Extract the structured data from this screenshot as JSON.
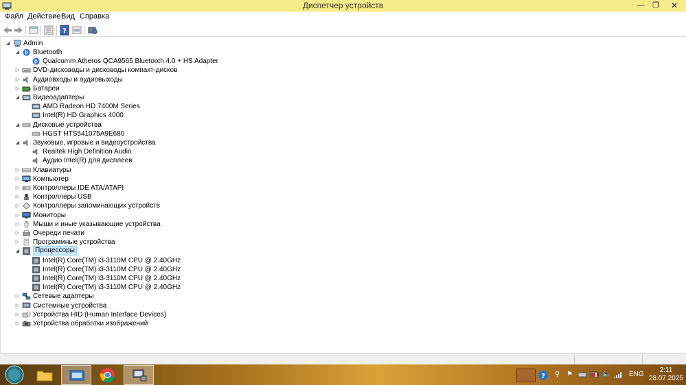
{
  "window": {
    "title": "Диспетчер устройств",
    "min_glyph": "—",
    "max_glyph": "❐",
    "close_glyph": "✕"
  },
  "menu": [
    {
      "label": "Файл"
    },
    {
      "label": "Действие"
    },
    {
      "label": "Вид"
    },
    {
      "label": "Справка"
    }
  ],
  "toolbar": {
    "icons": [
      "back-icon",
      "forward-icon",
      "properties-icon",
      "list-view-icon",
      "help-icon",
      "device-view-icon",
      "scan-hardware-icon"
    ]
  },
  "tree": {
    "root": "Admin",
    "nodes": [
      {
        "label": "Bluetooth",
        "level": 1,
        "expanded": true,
        "icon": "bluetooth-icon"
      },
      {
        "label": "Qualcomm Atheros QCA9565 Bluetooth 4.0 + HS Adapter",
        "level": 2,
        "icon": "bluetooth-icon"
      },
      {
        "label": "DVD-дисководы и дисководы компакт-дисков",
        "level": 1,
        "expanded": false,
        "icon": "dvd-drive-icon"
      },
      {
        "label": "Аудиовходы и аудиовыходы",
        "level": 1,
        "expanded": false,
        "icon": "speaker-icon"
      },
      {
        "label": "Батареи",
        "level": 1,
        "expanded": false,
        "icon": "battery-icon"
      },
      {
        "label": "Видеоадаптеры",
        "level": 1,
        "expanded": true,
        "icon": "display-adapter-icon"
      },
      {
        "label": "AMD Radeon HD 7400M Series",
        "level": 2,
        "icon": "display-adapter-icon"
      },
      {
        "label": "Intel(R) HD Graphics 4000",
        "level": 2,
        "icon": "display-adapter-icon"
      },
      {
        "label": "Дисковые устройства",
        "level": 1,
        "expanded": true,
        "icon": "disk-drive-icon"
      },
      {
        "label": "HGST HTS541075A9E680",
        "level": 2,
        "icon": "disk-drive-icon"
      },
      {
        "label": "Звуковые, игровые и видеоустройства",
        "level": 1,
        "expanded": true,
        "icon": "speaker-icon"
      },
      {
        "label": "Realtek High Definition Audio",
        "level": 2,
        "icon": "speaker-icon"
      },
      {
        "label": "Аудио Intel(R) для дисплеев",
        "level": 2,
        "icon": "speaker-icon"
      },
      {
        "label": "Клавиатуры",
        "level": 1,
        "expanded": false,
        "icon": "keyboard-icon"
      },
      {
        "label": "Компьютер",
        "level": 1,
        "expanded": false,
        "icon": "computer-icon"
      },
      {
        "label": "Контроллеры IDE ATA/ATAPI",
        "level": 1,
        "expanded": false,
        "icon": "ide-controller-icon"
      },
      {
        "label": "Контроллеры USB",
        "level": 1,
        "expanded": false,
        "icon": "usb-icon"
      },
      {
        "label": "Контроллеры запоминающих устройств",
        "level": 1,
        "expanded": false,
        "icon": "storage-controller-icon"
      },
      {
        "label": "Мониторы",
        "level": 1,
        "expanded": false,
        "icon": "monitor-icon"
      },
      {
        "label": "Мыши и иные указывающие устройства",
        "level": 1,
        "expanded": false,
        "icon": "mouse-icon"
      },
      {
        "label": "Очереди печати",
        "level": 1,
        "expanded": false,
        "icon": "printer-icon"
      },
      {
        "label": "Программные устройства",
        "level": 1,
        "expanded": false,
        "icon": "software-device-icon"
      },
      {
        "label": "Процессоры",
        "level": 1,
        "expanded": true,
        "icon": "processor-icon",
        "selected": true
      },
      {
        "label": "Intel(R) Core(TM) i3-3110M CPU @ 2.40GHz",
        "level": 2,
        "icon": "processor-icon"
      },
      {
        "label": "Intel(R) Core(TM) i3-3110M CPU @ 2.40GHz",
        "level": 2,
        "icon": "processor-icon"
      },
      {
        "label": "Intel(R) Core(TM) i3-3110M CPU @ 2.40GHz",
        "level": 2,
        "icon": "processor-icon"
      },
      {
        "label": "Intel(R) Core(TM) i3-3110M CPU @ 2.40GHz",
        "level": 2,
        "icon": "processor-icon"
      },
      {
        "label": "Сетевые адаптеры",
        "level": 1,
        "expanded": false,
        "icon": "network-adapter-icon"
      },
      {
        "label": "Системные устройства",
        "level": 1,
        "expanded": false,
        "icon": "system-device-icon"
      },
      {
        "label": "Устройства HID (Human Interface Devices)",
        "level": 1,
        "expanded": false,
        "icon": "hid-icon"
      },
      {
        "label": "Устройства обработки изображений",
        "level": 1,
        "expanded": false,
        "icon": "imaging-device-icon"
      }
    ]
  },
  "taskbar": {
    "items": [
      "start-orb-icon",
      "file-explorer-icon",
      "control-panel-icon",
      "chrome-icon",
      "device-manager-icon"
    ],
    "tray": {
      "language": "ENG",
      "time": "2:11",
      "date": "28.07.2025"
    }
  },
  "colors": {
    "titlebar": "#f7ec8a",
    "selection": "#cde8ff"
  }
}
